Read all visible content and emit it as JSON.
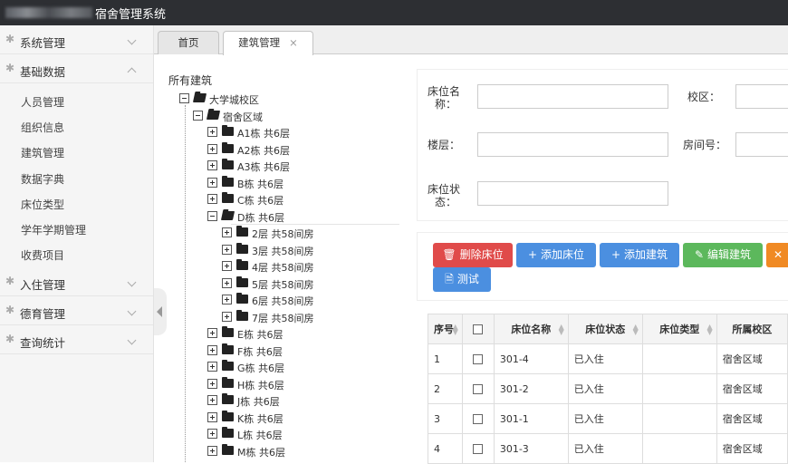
{
  "app": {
    "title": "宿舍管理系统"
  },
  "sidebar": {
    "groups": [
      {
        "label": "系统管理",
        "expanded": false,
        "items": []
      },
      {
        "label": "基础数据",
        "expanded": true,
        "items": [
          "人员管理",
          "组织信息",
          "建筑管理",
          "数据字典",
          "床位类型",
          "学年学期管理",
          "收费项目"
        ]
      },
      {
        "label": "入住管理",
        "expanded": false,
        "items": []
      },
      {
        "label": "德育管理",
        "expanded": false,
        "items": []
      },
      {
        "label": "查询统计",
        "expanded": false,
        "items": []
      }
    ]
  },
  "tabs": [
    {
      "label": "首页",
      "closable": false
    },
    {
      "label": "建筑管理",
      "closable": true,
      "active": true
    }
  ],
  "tree": {
    "title": "所有建筑",
    "nodes": [
      {
        "label": "大学城校区",
        "level": 0,
        "expanded": true
      },
      {
        "label": "宿舍区域",
        "level": 1,
        "expanded": true
      },
      {
        "label": "A1栋 共6层",
        "level": 2,
        "expanded": false
      },
      {
        "label": "A2栋 共6层",
        "level": 2,
        "expanded": false
      },
      {
        "label": "A3栋 共6层",
        "level": 2,
        "expanded": false
      },
      {
        "label": "B栋 共6层",
        "level": 2,
        "expanded": false
      },
      {
        "label": "C栋 共6层",
        "level": 2,
        "expanded": false
      },
      {
        "label": "D栋 共6层",
        "level": 2,
        "expanded": true
      },
      {
        "label": "2层 共58间房",
        "level": 3,
        "expanded": false
      },
      {
        "label": "3层 共58间房",
        "level": 3,
        "expanded": false
      },
      {
        "label": "4层 共58间房",
        "level": 3,
        "expanded": false
      },
      {
        "label": "5层 共58间房",
        "level": 3,
        "expanded": false
      },
      {
        "label": "6层 共58间房",
        "level": 3,
        "expanded": false
      },
      {
        "label": "7层 共58间房",
        "level": 3,
        "expanded": false
      },
      {
        "label": "E栋 共6层",
        "level": 2,
        "expanded": false
      },
      {
        "label": "F栋 共6层",
        "level": 2,
        "expanded": false
      },
      {
        "label": "G栋 共6层",
        "level": 2,
        "expanded": false
      },
      {
        "label": "H栋 共6层",
        "level": 2,
        "expanded": false
      },
      {
        "label": "J栋 共6层",
        "level": 2,
        "expanded": false
      },
      {
        "label": "K栋 共6层",
        "level": 2,
        "expanded": false
      },
      {
        "label": "L栋 共6层",
        "level": 2,
        "expanded": false
      },
      {
        "label": "M栋 共6层",
        "level": 2,
        "expanded": false
      }
    ]
  },
  "form": {
    "bed_name_label_1": "床位名",
    "bed_name_label_2": "称：",
    "bed_name_value": "",
    "campus_label": "校区：",
    "campus_value": "",
    "floor_label": "楼层：",
    "floor_value": "",
    "room_label": "房间号：",
    "room_value": "",
    "bed_status_label_1": "床位状",
    "bed_status_label_2": "态：",
    "bed_status_value": ""
  },
  "toolbar": {
    "delete_bed": "删除床位",
    "add_bed": "添加床位",
    "add_building": "添加建筑",
    "edit_building": "编辑建筑",
    "test": "测试",
    "colors": {
      "delete": "#e04b4a",
      "add": "#4b8fe0",
      "edit": "#5cb85c",
      "extra": "#f08a24"
    }
  },
  "table": {
    "headers": [
      "序号",
      "",
      "床位名称",
      "床位状态",
      "床位类型",
      "所属校区"
    ],
    "rows": [
      {
        "no": "1",
        "name": "301-4",
        "status": "已入住",
        "type": "",
        "campus": "宿舍区域"
      },
      {
        "no": "2",
        "name": "301-2",
        "status": "已入住",
        "type": "",
        "campus": "宿舍区域"
      },
      {
        "no": "3",
        "name": "301-1",
        "status": "已入住",
        "type": "",
        "campus": "宿舍区域"
      },
      {
        "no": "4",
        "name": "301-3",
        "status": "已入住",
        "type": "",
        "campus": "宿舍区域"
      }
    ]
  }
}
